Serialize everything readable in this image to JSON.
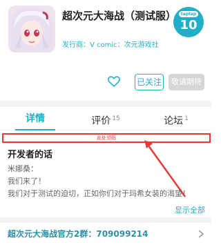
{
  "app": {
    "title": "超次元大海战（测试服）",
    "publisher": "发行商：V comic：次元游戏社"
  },
  "rating": {
    "top_label": "taptap",
    "value": "10"
  },
  "actions": {
    "follow_label": "已关注",
    "wait_label": "敬请期待"
  },
  "tabs": [
    {
      "label": "详情",
      "count": ""
    },
    {
      "label": "评价",
      "count": "15"
    },
    {
      "label": "论坛",
      "count": "1"
    }
  ],
  "annotation": {
    "label": "此处领码"
  },
  "developer": {
    "title": "开发者的话",
    "lines": [
      "米娜桑：",
      "我们来了！",
      "我们对于测试的迫切，正如你们对于玛希女装的渴望！"
    ],
    "show_all": "显示全部"
  },
  "group": {
    "text": "超次元大海战官方2群：709099214"
  },
  "colors": {
    "accent": "#1fb0c7",
    "annotation": "#e53935"
  }
}
